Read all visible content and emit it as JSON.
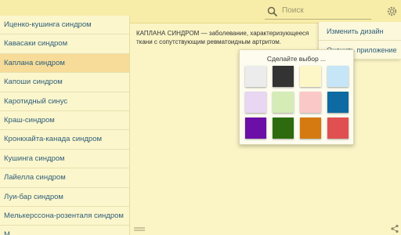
{
  "search": {
    "placeholder": "Поиск"
  },
  "sidebar": {
    "items": [
      {
        "label": "Иценко-кушинга синдром"
      },
      {
        "label": "Кавасаки синдром"
      },
      {
        "label": "Каплана синдром",
        "selected": true
      },
      {
        "label": "Капоши синдром"
      },
      {
        "label": "Каротидный синус"
      },
      {
        "label": "Краш-синдром"
      },
      {
        "label": "Кронкхайта-канада синдром"
      },
      {
        "label": "Кушинга синдром"
      },
      {
        "label": "Лайелла синдром"
      },
      {
        "label": "Луи-бар синдром"
      },
      {
        "label": "Мелькерссона-розенталя синдром"
      },
      {
        "label": "М..."
      }
    ]
  },
  "content": {
    "headword": "КАПЛАНА СИНДРОМ",
    "definition_line1": " — заболевание, характеризующееся",
    "definition_line2": "ткани с сопутствующим ревматоидным артритом."
  },
  "menu": {
    "items": [
      {
        "label": "Изменить дизайн"
      },
      {
        "label": "Оценить приложение"
      }
    ]
  },
  "picker": {
    "title": "Сделайте выбор ...",
    "colors": [
      "#ececec",
      "#333333",
      "#fdf7c8",
      "#c6e6f7",
      "#e8d6f3",
      "#d5ecb6",
      "#fbc8c8",
      "#0d6aa2",
      "#6c0fa6",
      "#2d6b0e",
      "#d47a10",
      "#e05050"
    ]
  },
  "icons": {
    "search": "search-icon",
    "settings": "gear-icon",
    "share": "share-icon"
  }
}
